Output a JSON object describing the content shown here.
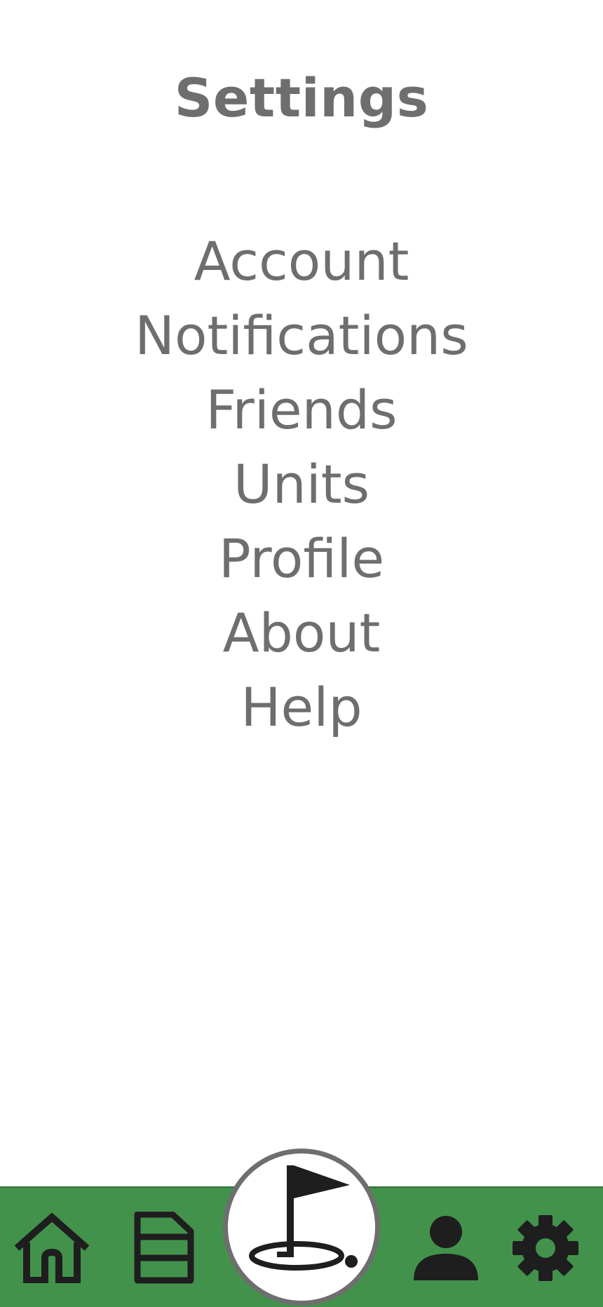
{
  "header": {
    "title": "Settings"
  },
  "menu": {
    "items": [
      {
        "label": "Account"
      },
      {
        "label": "Notifications"
      },
      {
        "label": "Friends"
      },
      {
        "label": "Units"
      },
      {
        "label": "Profile"
      },
      {
        "label": "About"
      },
      {
        "label": "Help"
      }
    ]
  },
  "bottom_nav": {
    "background_color": "#43924c",
    "items": [
      {
        "icon": "home-icon"
      },
      {
        "icon": "scorecard-icon"
      },
      {
        "icon": "golf-flag-icon"
      },
      {
        "icon": "person-icon"
      },
      {
        "icon": "gear-icon"
      }
    ]
  },
  "colors": {
    "text": "#6e6e6e",
    "nav_background": "#43924c",
    "icon": "#1e1e1e"
  }
}
